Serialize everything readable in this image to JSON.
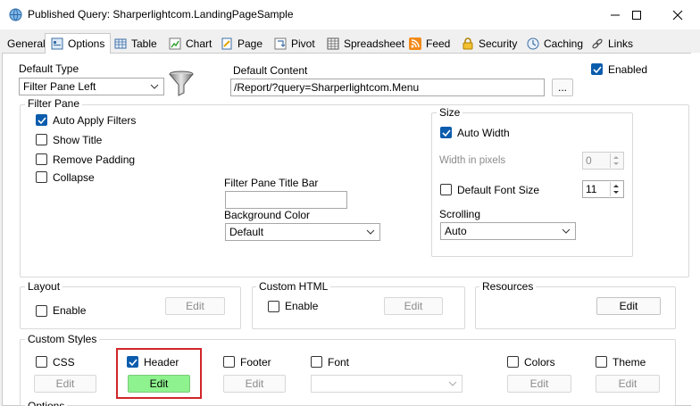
{
  "window": {
    "title": "Published Query: Sharperlightcom.LandingPageSample"
  },
  "tabs": [
    {
      "label": "General",
      "icon": "none"
    },
    {
      "label": "Options",
      "icon": "options-icon"
    },
    {
      "label": "Table",
      "icon": "table-icon"
    },
    {
      "label": "Chart",
      "icon": "chart-icon"
    },
    {
      "label": "Page",
      "icon": "page-icon"
    },
    {
      "label": "Pivot",
      "icon": "pivot-icon"
    },
    {
      "label": "Spreadsheet",
      "icon": "spreadsheet-icon"
    },
    {
      "label": "Feed",
      "icon": "rss-feed-icon"
    },
    {
      "label": "Security",
      "icon": "lock-icon"
    },
    {
      "label": "Caching",
      "icon": "clock-icon"
    },
    {
      "label": "Links",
      "icon": "link-icon"
    }
  ],
  "options": {
    "default_type_label": "Default Type",
    "default_type_value": "Filter Pane Left",
    "default_content_label": "Default Content",
    "default_content_value": "/Report/?query=Sharperlightcom.Menu",
    "browse_label": "...",
    "enabled_label": "Enabled",
    "enabled_checked": true
  },
  "filter_pane": {
    "title": "Filter Pane",
    "auto_apply": {
      "label": "Auto Apply Filters",
      "checked": true
    },
    "show_title": {
      "label": "Show Title",
      "checked": false
    },
    "remove_padding": {
      "label": "Remove Padding",
      "checked": false
    },
    "collapse": {
      "label": "Collapse",
      "checked": false
    },
    "title_bar_label": "Filter Pane Title Bar",
    "title_bar_value": "",
    "background_color_label": "Background Color",
    "background_color_value": "Default"
  },
  "size": {
    "title": "Size",
    "auto_width": {
      "label": "Auto Width",
      "checked": true
    },
    "width_label": "Width in pixels",
    "width_value": "0",
    "default_font_size": {
      "label": "Default Font Size",
      "checked": false
    },
    "font_size_value": "11",
    "scrolling_label": "Scrolling",
    "scrolling_value": "Auto"
  },
  "layout": {
    "title": "Layout",
    "enable_label": "Enable",
    "edit_label": "Edit"
  },
  "custom_html": {
    "title": "Custom HTML",
    "enable_label": "Enable",
    "edit_label": "Edit"
  },
  "resources": {
    "title": "Resources",
    "edit_label": "Edit"
  },
  "custom_styles": {
    "title": "Custom Styles",
    "css": {
      "label": "CSS",
      "edit": "Edit",
      "checked": false
    },
    "header": {
      "label": "Header",
      "edit": "Edit",
      "checked": true
    },
    "footer": {
      "label": "Footer",
      "edit": "Edit",
      "checked": false
    },
    "font": {
      "label": "Font",
      "value": "",
      "checked": false
    },
    "colors": {
      "label": "Colors",
      "edit": "Edit",
      "checked": false
    },
    "theme": {
      "label": "Theme",
      "edit": "Edit",
      "checked": false
    }
  },
  "options_group": {
    "title": "Options"
  },
  "colors": {
    "accent": "#0b5cad",
    "highlight": "#d1262a",
    "header_edit_bg": "#8ef28e"
  }
}
